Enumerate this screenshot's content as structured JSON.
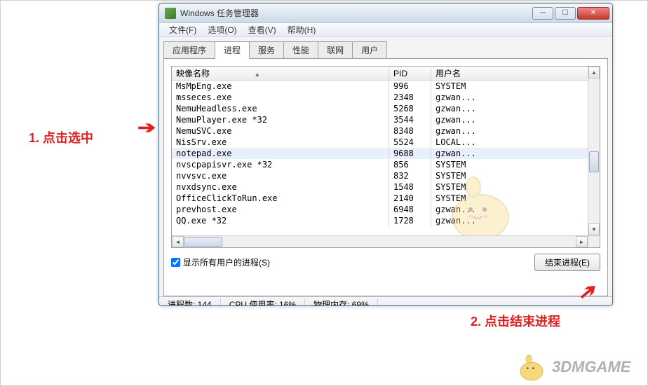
{
  "title": "Windows 任务管理器",
  "menu": {
    "file": "文件(F)",
    "options": "选项(O)",
    "view": "查看(V)",
    "help": "帮助(H)"
  },
  "tabs": {
    "apps": "应用程序",
    "processes": "进程",
    "services": "服务",
    "performance": "性能",
    "network": "联网",
    "users": "用户"
  },
  "columns": {
    "image_name": "映像名称",
    "pid": "PID",
    "user": "用户名"
  },
  "processes": [
    {
      "name": "MsMpEng.exe",
      "pid": "996",
      "user": "SYSTEM"
    },
    {
      "name": "msseces.exe",
      "pid": "2348",
      "user": "gzwan..."
    },
    {
      "name": "NemuHeadless.exe",
      "pid": "5268",
      "user": "gzwan..."
    },
    {
      "name": "NemuPlayer.exe *32",
      "pid": "3544",
      "user": "gzwan..."
    },
    {
      "name": "NemuSVC.exe",
      "pid": "8348",
      "user": "gzwan..."
    },
    {
      "name": "NisSrv.exe",
      "pid": "5524",
      "user": "LOCAL..."
    },
    {
      "name": "notepad.exe",
      "pid": "9688",
      "user": "gzwan...",
      "highlight": true
    },
    {
      "name": "nvscpapisvr.exe *32",
      "pid": "856",
      "user": "SYSTEM"
    },
    {
      "name": "nvvsvc.exe",
      "pid": "832",
      "user": "SYSTEM"
    },
    {
      "name": "nvxdsync.exe",
      "pid": "1548",
      "user": "SYSTEM"
    },
    {
      "name": "OfficeClickToRun.exe",
      "pid": "2140",
      "user": "SYSTEM"
    },
    {
      "name": "prevhost.exe",
      "pid": "6948",
      "user": "gzwan..."
    },
    {
      "name": "QQ.exe *32",
      "pid": "1728",
      "user": "gzwan..."
    }
  ],
  "checkbox_label": "显示所有用户的进程(S)",
  "end_button": "结束进程(E)",
  "status": {
    "proc_count": "进程数: 144",
    "cpu": "CPU 使用率: 16%",
    "mem": "物理内存: 69%"
  },
  "annotations": {
    "a1": "1. 点击选中",
    "a2": "2. 点击结束进程"
  },
  "logo": "3DMGAME"
}
